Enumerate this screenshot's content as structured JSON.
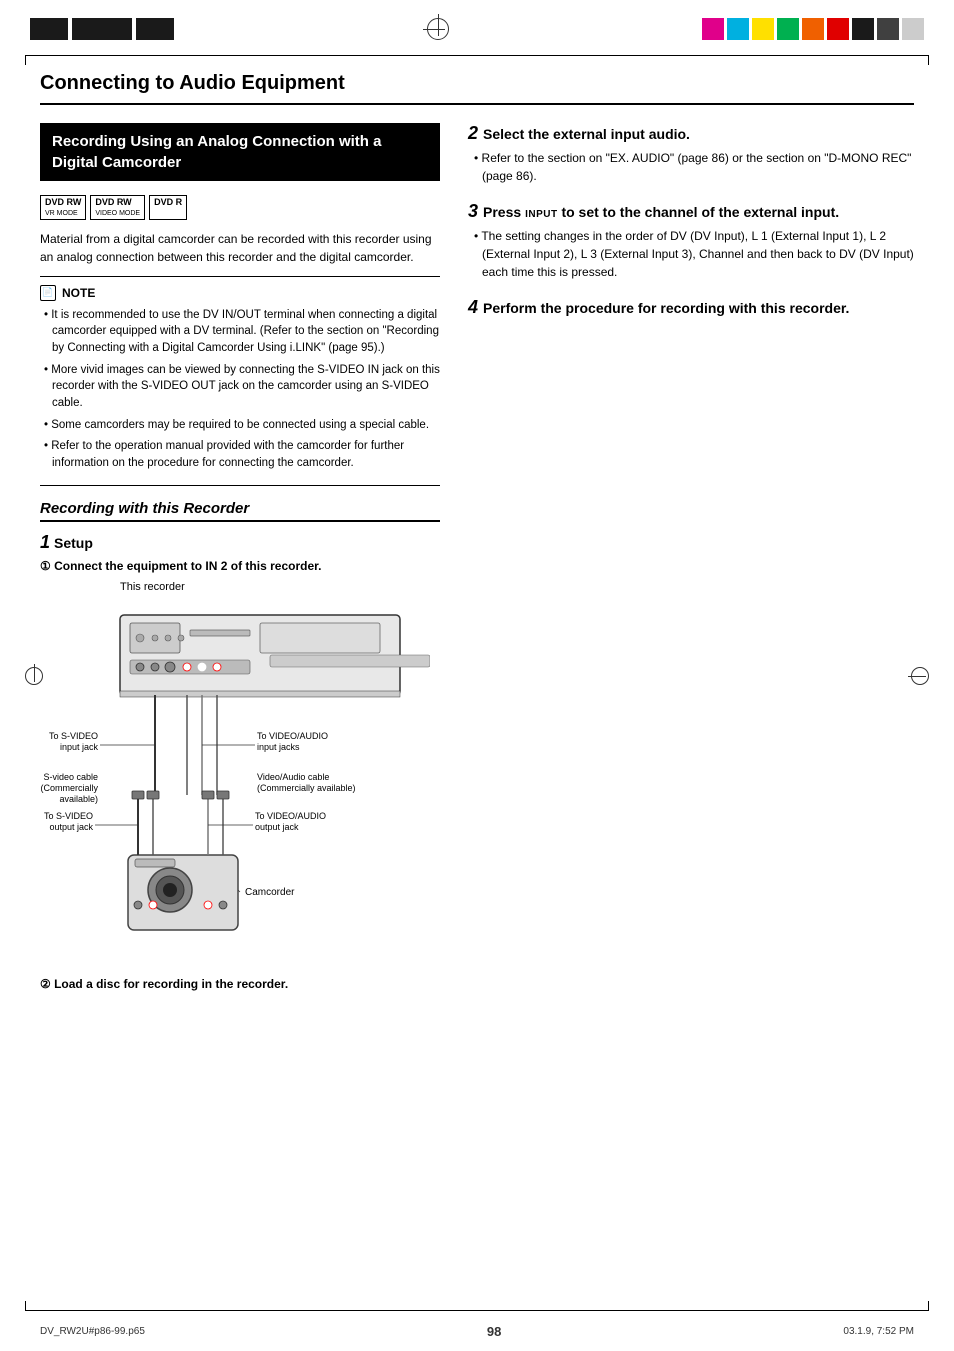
{
  "page": {
    "title": "Connecting to Audio Equipment",
    "number": "98",
    "footer_left": "DV_RW2U#p86-99.p65",
    "footer_center": "98",
    "footer_right": "03.1.9, 7:52 PM"
  },
  "section_heading": "Recording Using an Analog Connection with a Digital Camcorder",
  "dvd_badges": [
    {
      "main": "DVD RW",
      "sub": "VR MODE"
    },
    {
      "main": "DVD RW",
      "sub": "VIDEO MODE"
    },
    {
      "main": "DVD R",
      "sub": ""
    }
  ],
  "intro_text": "Material from a digital camcorder can be recorded with this recorder using an analog connection between this recorder and the digital camcorder.",
  "note_title": "NOTE",
  "note_items": [
    "It is recommended to use the DV IN/OUT terminal when connecting a digital camcorder equipped with a DV terminal. (Refer to the section on \"Recording by Connecting with a Digital Camcorder Using i.LINK\" (page 95).)",
    "More vivid images can be viewed by connecting the S-VIDEO IN jack on this recorder with the S-VIDEO OUT jack on the camcorder using an S-VIDEO cable.",
    "Some camcorders may be required to be connected using a special cable.",
    "Refer to the operation manual provided with the camcorder for further information on the procedure for connecting the camcorder."
  ],
  "sub_section": "Recording with this Recorder",
  "step1_label": "Setup",
  "step1_sub1": "Connect the equipment to IN 2 of this recorder.",
  "diagram_label": "This recorder",
  "diagram_labels": {
    "svideo_input": "To S-VIDEO\ninput jack",
    "video_audio_input": "To VIDEO/AUDIO\ninput jacks",
    "svideo_cable": "S-video cable\n(Commercially\navailable)",
    "video_audio_cable": "Video/Audio cable\n(Commercially available)",
    "svideo_output": "To S-VIDEO\noutput jack",
    "video_audio_output": "To VIDEO/AUDIO\noutput jack",
    "camcorder": "Camcorder"
  },
  "step1_sub2": "Load a disc for recording in the recorder.",
  "step2_heading": "Select the external input audio.",
  "step2_bullets": [
    "Refer to the section on “EX. AUDIO” (page 86) or the section on “D-MONO REC” (page 86)."
  ],
  "step3_heading": "Press INPUT to set to the channel of the external input.",
  "step3_bullets": [
    "The setting changes in the order of DV (DV Input), L 1 (External Input 1), L 2 (External Input 2), L 3 (External Input 3), Channel and then back to DV (DV Input) each time this is pressed."
  ],
  "step4_heading": "Perform the procedure for recording with this recorder.",
  "colors": {
    "magenta": "#e0008a",
    "cyan": "#00b0e0",
    "yellow": "#ffe000",
    "green": "#00b050",
    "orange": "#f06000",
    "red": "#e00000",
    "black": "#1a1a1a",
    "dark_gray": "#404040",
    "light_gray": "#cccccc"
  }
}
